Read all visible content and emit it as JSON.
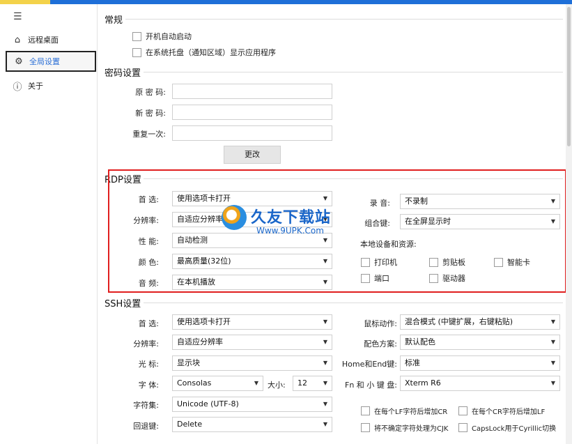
{
  "sidebar": {
    "items": [
      {
        "icon": "home-icon",
        "label": "远程桌面"
      },
      {
        "icon": "gear-icon",
        "label": "全局设置"
      },
      {
        "icon": "info-icon",
        "label": "关于"
      }
    ]
  },
  "general": {
    "title": "常规",
    "autostart": "开机自动启动",
    "tray": "在系统托盘（通知区域）显示应用程序"
  },
  "password": {
    "title": "密码设置",
    "old_label": "原 密 码:",
    "new_label": "新 密 码:",
    "repeat_label": "重复一次:",
    "change_button": "更改"
  },
  "rdp": {
    "title": "RDP设置",
    "open_label": "首  选:",
    "open_value": "使用选项卡打开",
    "resolution_label": "分辨率:",
    "resolution_value": "自适应分辨率",
    "performance_label": "性  能:",
    "performance_value": "自动检测",
    "color_label": "颜  色:",
    "color_value": "最高质量(32位)",
    "audio_label": "音  频:",
    "audio_value": "在本机播放",
    "record_label": "录  音:",
    "record_value": "不录制",
    "combo_label": "组合键:",
    "combo_value": "在全屏显示时",
    "local_label": "本地设备和资源:",
    "printer": "打印机",
    "clipboard": "剪贴板",
    "smartcard": "智能卡",
    "port": "端口",
    "drive": "驱动器"
  },
  "ssh": {
    "title": "SSH设置",
    "open_label": "首  选:",
    "open_value": "使用选项卡打开",
    "resolution_label": "分辨率:",
    "resolution_value": "自适应分辨率",
    "cursor_label": "光  标:",
    "cursor_value": "显示块",
    "font_label": "字  体:",
    "font_value": "Consolas",
    "size_label": "大小:",
    "size_value": "12",
    "charset_label": "字符集:",
    "charset_value": "Unicode (UTF-8)",
    "backspace_label": "回退键:",
    "backspace_value": "Delete",
    "mouse_label": "鼠标动作:",
    "mouse_value": "混合模式 (中键扩展，右键粘贴)",
    "scheme_label": "配色方案:",
    "scheme_value": "默认配色",
    "homeend_label": "Home和End键:",
    "homeend_value": "标准",
    "fn_label": "Fn 和 小 键 盘:",
    "fn_value": "Xterm R6",
    "lf_cr": "在每个LF字符后增加CR",
    "cr_lf": "在每个CR字符后增加LF",
    "cjk": "将不确定字符处理为CJK",
    "capslock": "CapsLock用于Cyrillic切换"
  },
  "watermark": {
    "big": "久友下载站",
    "small": "Www.9UPK.Com"
  }
}
